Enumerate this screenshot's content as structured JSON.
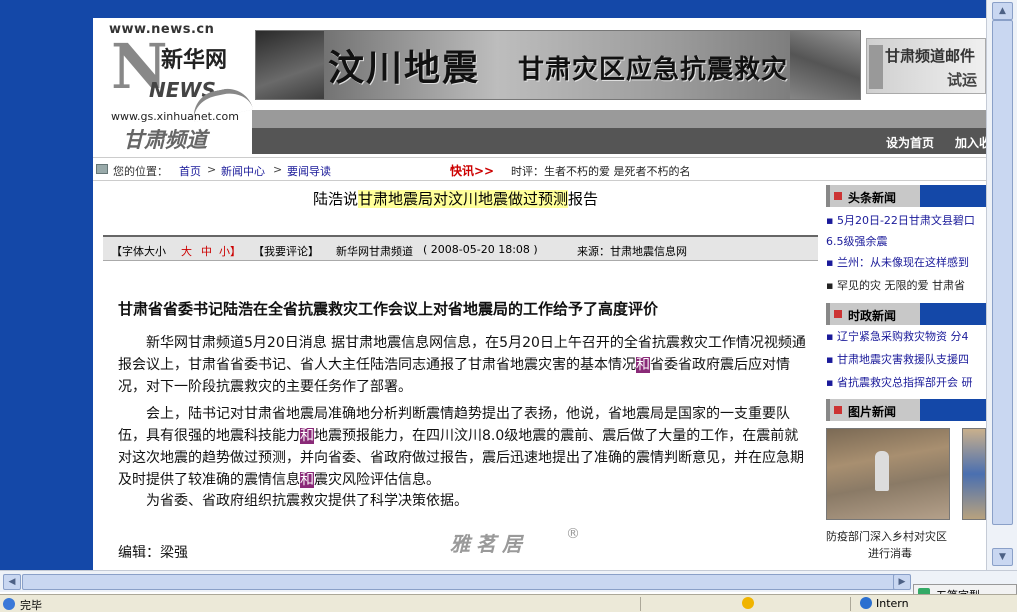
{
  "logo": {
    "domain": "www.news.cn",
    "big_letter": "N",
    "xinhua": "新华网",
    "news": "NEWS",
    "sub_domain": "www.gs.xinhuanet.com",
    "channel": "甘肃频道"
  },
  "banner": {
    "quake_text": "汶川地震",
    "relief_text": "甘肃灾区应急抗震救灾"
  },
  "side_banner": {
    "line1": "甘肃频道邮件",
    "line2": "试运"
  },
  "navbar": {
    "set_home": "设为首页",
    "add_favorite": "加入收"
  },
  "breadcrumb": {
    "location_label": "您的位置：",
    "items": [
      "首页",
      "新闻中心",
      "要闻导读"
    ],
    "separator": ">",
    "flash_label": "快讯>>",
    "ticker": "时评：生者不朽的爱 是死者不朽的名"
  },
  "article": {
    "title_prefix": "陆浩说",
    "title_highlight": "甘肃地震局对汶川地震做过预测",
    "title_suffix": "报告",
    "info": {
      "font_size_label": "【字体大小",
      "size_large": "大",
      "size_medium": "中",
      "size_small": "小】",
      "comment": "【我要评论】",
      "source_site": "新华网甘肃频道",
      "date": "( 2008-05-20 18:08 )",
      "source": "来源：甘肃地震信息网"
    },
    "headline": "甘肃省省委书记陆浩在全省抗震救灾工作会议上对省地震局的工作给予了高度评价",
    "para1_a": "新华网甘肃频道5月20日消息 据甘肃地震信息网信息，在5月20日上午召开的全省抗震救灾工作情况视频通报会议上，甘肃省省委书记、省人大主任陆浩同志通报了甘肃省地震灾害的基本情况",
    "para1_hl": "和",
    "para1_b": "省委省政府震后应对情况，对下一阶段抗震救灾的主要任务作了部署。",
    "para2_a": "会上，陆书记对甘肃省地震局准确地分析判断震情趋势提出了表扬，他说，省地震局是国家的一支重要队伍，具有很强的地震科技能力",
    "para2_hl1": "和",
    "para2_b": "地震预报能力，在四川汶川8.0级地震的震前、震后做了大量的工作，在震前就对这次地震的趋势做过预测，并向省委、省政府做过报告，震后迅速地提出了准确的震情判断意见，并在应急期及时提供了较准确的震情信息",
    "para2_hl2": "和",
    "para2_c": "震灾风险评估信息。",
    "para3": "为省委、省政府组织抗震救灾提供了科学决策依据。",
    "editor": "编辑：梁强"
  },
  "watermark": {
    "brand": "雅茗居",
    "reg": "®"
  },
  "sidebar": {
    "headline_section": "头条新闻",
    "headline_items": [
      "▪ 5月20日-22日甘肃文县碧口",
      "6.5级强余震",
      "▪ 兰州：从未像现在这样感到",
      "▪ 罕见的灾 无限的爱 甘肃省"
    ],
    "politics_section": "时政新闻",
    "politics_items": [
      "▪ 辽宁紧急采购救灾物资 分4",
      "▪ 甘肃地震灾害救援队支援四",
      "▪ 省抗震救灾总指挥部开会 研"
    ],
    "photo_section": "图片新闻",
    "photo_caption_line1": "防疫部门深入乡村对灾区",
    "photo_caption_line2": "进行消毒"
  },
  "ime": {
    "label": "五笔字型"
  },
  "statusbar": {
    "status": "完毕",
    "zone": "Intern"
  },
  "colors": {
    "brand_blue": "#1448a8",
    "highlight_yellow": "#ffff99",
    "highlight_purple": "#8a2a78",
    "flash_red": "#cc0000"
  }
}
